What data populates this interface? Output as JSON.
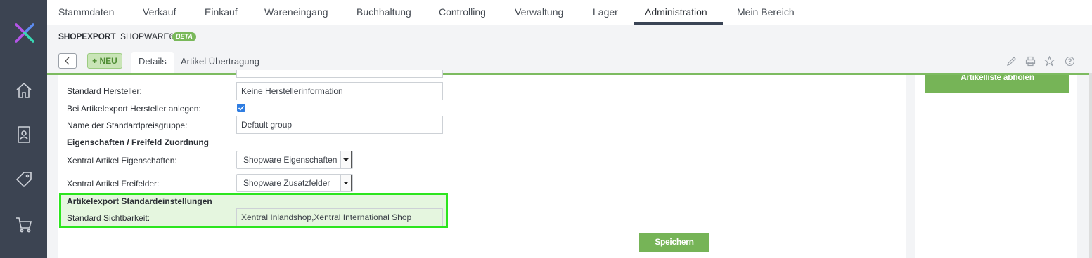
{
  "nav": {
    "items": [
      "Stammdaten",
      "Verkauf",
      "Einkauf",
      "Wareneingang",
      "Buchhaltung",
      "Controlling",
      "Verwaltung",
      "Lager",
      "Administration",
      "Mein Bereich"
    ],
    "active": "Administration"
  },
  "module": {
    "title": "SHOPEXPORT",
    "subtitle": "SHOPWARE6",
    "badge": "BETA"
  },
  "tabs": {
    "new_label": "+ NEU",
    "items": [
      "Details",
      "Artikel Übertragung"
    ],
    "active": "Details"
  },
  "sidebar_icons": [
    "logo-icon",
    "home-icon",
    "contacts-icon",
    "tag-icon",
    "cart-icon"
  ],
  "tool_icons": [
    "edit-icon",
    "print-icon",
    "star-icon",
    "help-icon"
  ],
  "form": {
    "standard_hersteller": {
      "label": "Standard Hersteller:",
      "value": "Keine Herstellerinformation"
    },
    "hersteller_anlegen": {
      "label": "Bei Artikelexport Hersteller anlegen:",
      "checked": true
    },
    "preisgruppe": {
      "label": "Name der Standardpreisgruppe:",
      "value": "Default group"
    },
    "section_eigenschaften": "Eigenschaften / Freifeld Zuordnung",
    "eigenschaften": {
      "label": "Xentral Artikel Eigenschaften:",
      "value": "Shopware Eigenschaften"
    },
    "freifelder": {
      "label": "Xentral Artikel Freifelder:",
      "value": "Shopware Zusatzfelder"
    },
    "section_export": "Artikelexport Standardeinstellungen",
    "sichtbarkeit": {
      "label": "Standard Sichtbarkeit:",
      "value": "Xentral Inlandshop,Xentral International Shop"
    }
  },
  "buttons": {
    "save": "Speichern",
    "fetch_list": "Artikelliste abholen"
  },
  "colors": {
    "accent_green": "#76b457",
    "sidebar": "#3c4452",
    "highlight_border": "#2ce51e"
  }
}
